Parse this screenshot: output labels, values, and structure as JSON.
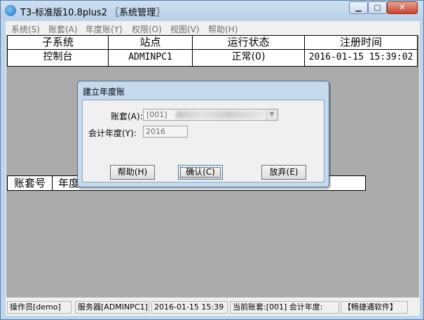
{
  "window": {
    "title": "T3-标准版10.8plus2 〖系统管理〗",
    "min_symbol": "▁",
    "max_symbol": "▢",
    "close_symbol": "✕"
  },
  "menu": [
    "系统(S)",
    "账套(A)",
    "年度账(Y)",
    "权限(O)",
    "视图(V)",
    "帮助(H)"
  ],
  "subsystem_table": {
    "columns": [
      "子系统",
      "站点",
      "运行状态",
      "注册时间"
    ],
    "rows": [
      [
        "控制台",
        "ADMINPC1",
        "正常(0)",
        "2016-01-15 15:39:02"
      ]
    ]
  },
  "account_table": {
    "columns": [
      "账套号",
      "年度"
    ]
  },
  "dialog": {
    "title": "建立年度账",
    "account_label": "账套(A):",
    "account_value": "[001]",
    "year_label": "会计年度(Y):",
    "year_value": "2016",
    "help_button": "帮助(H)",
    "ok_button": "确认(C)",
    "cancel_button": "放弃(E)"
  },
  "status": {
    "operator": "操作员[demo]",
    "server": "服务器[ADMINPC1]",
    "datetime": "2016-01-15 15:39",
    "current": "当前账套:[001] 会计年度:",
    "brand": "【畅捷通软件】"
  }
}
